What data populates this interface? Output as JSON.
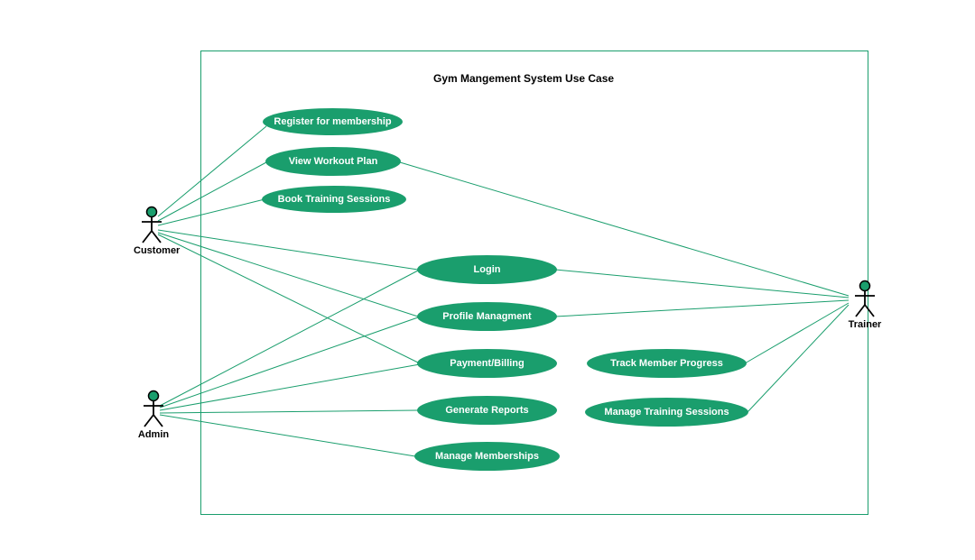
{
  "diagram": {
    "title": "Gym Mangement System Use Case",
    "actors": {
      "customer": {
        "label": "Customer"
      },
      "admin": {
        "label": "Admin"
      },
      "trainer": {
        "label": "Trainer"
      }
    },
    "usecases": {
      "register": {
        "label": "Register for membership"
      },
      "view_plan": {
        "label": "View Workout Plan"
      },
      "book_sessions": {
        "label": "Book Training Sessions"
      },
      "login": {
        "label": "Login"
      },
      "profile": {
        "label": "Profile Managment"
      },
      "payment": {
        "label": "Payment/Billing"
      },
      "reports": {
        "label": "Generate Reports"
      },
      "memberships": {
        "label": "Manage Memberships"
      },
      "track_progress": {
        "label": "Track Member Progress"
      },
      "manage_training": {
        "label": "Manage Training Sessions"
      }
    },
    "colors": {
      "accent": "#1a9e6d",
      "text_on_accent": "#ffffff"
    }
  }
}
